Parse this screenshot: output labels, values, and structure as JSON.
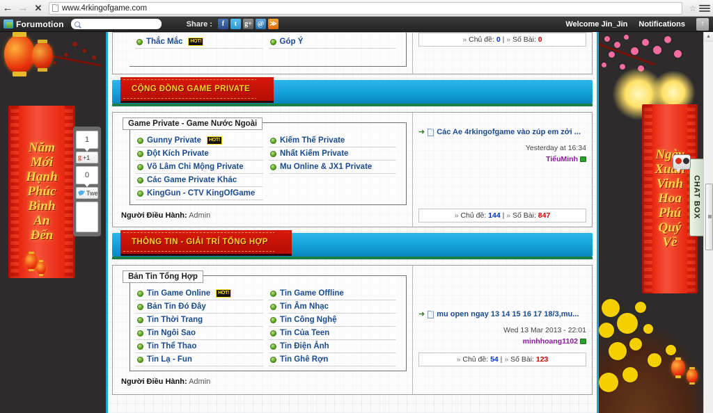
{
  "browser": {
    "back_icon": "←",
    "forward_icon": "→",
    "stop_icon": "✕",
    "url": "www.4rkingofgame.com",
    "star_icon": "☆"
  },
  "toolbar": {
    "brand": "Forumotion",
    "search_placeholder": "",
    "search_value": "",
    "share_label": "Share :",
    "share_icons": [
      {
        "name": "facebook-icon",
        "glyph": "f",
        "color": "#3b5998"
      },
      {
        "name": "twitter-icon",
        "glyph": "t",
        "color": "#2a9ad4"
      },
      {
        "name": "googleplus-icon",
        "glyph": "g+",
        "color": "#5a5a5a"
      },
      {
        "name": "email-icon",
        "glyph": "@",
        "color": "#2a6fa8"
      },
      {
        "name": "rss-icon",
        "glyph": "≫",
        "color": "#e2690c"
      }
    ],
    "welcome": "Welcome Jin_Jin",
    "notifications": "Notifications",
    "scroll_top_icon": "↑"
  },
  "social_widget": {
    "gplus_count": "1",
    "gplus_label": "+1",
    "gplus_g": "g",
    "tweet_count": "0",
    "tweet_label": "Tweet"
  },
  "decor": {
    "left_banner_chars": [
      "Năm",
      "Mới",
      "Hạnh",
      "Phúc",
      "Bình",
      "An",
      "Đến"
    ],
    "right_banner_chars": [
      "Ngày",
      "Xuân",
      "Vinh",
      "Hoa",
      "Phú",
      "Quý",
      "Về"
    ],
    "chatbox_label": "CHAT BOX"
  },
  "labels": {
    "moderator_prefix": "Người Điều Hành:",
    "topics_label": "Chủ đề:",
    "posts_label": "Số Bài:",
    "hot_badge": "HOT!",
    "chev": "»",
    "arrow": "➜",
    "separator": "|"
  },
  "sections": [
    {
      "id": "section-partial-top",
      "banner": null,
      "legend": null,
      "columns": [
        [
          {
            "label": "Thắc Mắc",
            "hot": true
          },
          {
            "label": "",
            "empty": true
          }
        ],
        [
          {
            "label": "Góp Ý",
            "hot": false
          }
        ]
      ],
      "moderator": null,
      "last_post": {
        "title": null,
        "date": null,
        "author": null,
        "topics": "0",
        "posts": "0"
      }
    },
    {
      "id": "section-game-private",
      "banner": "CỘNG ĐỒNG GAME PRIVATE",
      "legend": "Game Private - Game Nước Ngoài",
      "columns": [
        [
          {
            "label": "Gunny Private",
            "hot": true
          },
          {
            "label": "Đột Kích Private",
            "hot": false
          },
          {
            "label": "Võ Lâm Chi Mộng Private",
            "hot": false
          },
          {
            "label": "Các Game Private Khác",
            "hot": false
          },
          {
            "label": "KingGun - CTV KingOfGame",
            "hot": false
          }
        ],
        [
          {
            "label": "Kiếm Thế Private",
            "hot": false
          },
          {
            "label": "Nhất Kiếm Private",
            "hot": false
          },
          {
            "label": "Mu Online & JX1 Private",
            "hot": false
          }
        ]
      ],
      "moderator": "Admin",
      "last_post": {
        "title": "Các Ae 4rkingofgame vào zúp em zởi ...",
        "date": "Yesterday at 16:34",
        "author": "TiểuMinh",
        "topics": "144",
        "posts": "847"
      }
    },
    {
      "id": "section-thong-tin",
      "banner": "THÔNG TIN - GIẢI TRÍ TỔNG HỢP",
      "legend": "Bản Tin Tổng Hợp",
      "columns": [
        [
          {
            "label": "Tin Game Online",
            "hot": true
          },
          {
            "label": "Bản Tin Đó Đây",
            "hot": false
          },
          {
            "label": "Tin Thời Trang",
            "hot": false
          },
          {
            "label": "Tin Ngôi Sao",
            "hot": false
          },
          {
            "label": "Tin Thể Thao",
            "hot": false
          },
          {
            "label": "Tin Lạ - Fun",
            "hot": false
          }
        ],
        [
          {
            "label": "Tin Game Offline",
            "hot": false
          },
          {
            "label": "Tin Âm Nhạc",
            "hot": false
          },
          {
            "label": "Tin Công Nghệ",
            "hot": false
          },
          {
            "label": "Tin Của Teen",
            "hot": false
          },
          {
            "label": "Tin Điện Ảnh",
            "hot": false
          },
          {
            "label": "Tin Ghê Rợn",
            "hot": false
          }
        ]
      ],
      "moderator": "Admin",
      "last_post": {
        "title": "mu open ngay 13 14 15 16 17 18/3,mu...",
        "date": "Wed 13 Mar 2013 - 22:01",
        "author": "minhhoang1102",
        "topics": "54",
        "posts": "123"
      }
    }
  ],
  "scrollbar": {
    "up_icon": "▲"
  },
  "colors": {
    "accent_blue": "#1fa5dc",
    "ribbon_red": "#c41106",
    "ribbon_text": "#ffd22e",
    "link_blue": "#1b4b8f",
    "stat_blue": "#0032c8",
    "stat_red": "#d00000",
    "author_purple": "#8a1a9c",
    "page_dark": "#2d2b2c"
  }
}
